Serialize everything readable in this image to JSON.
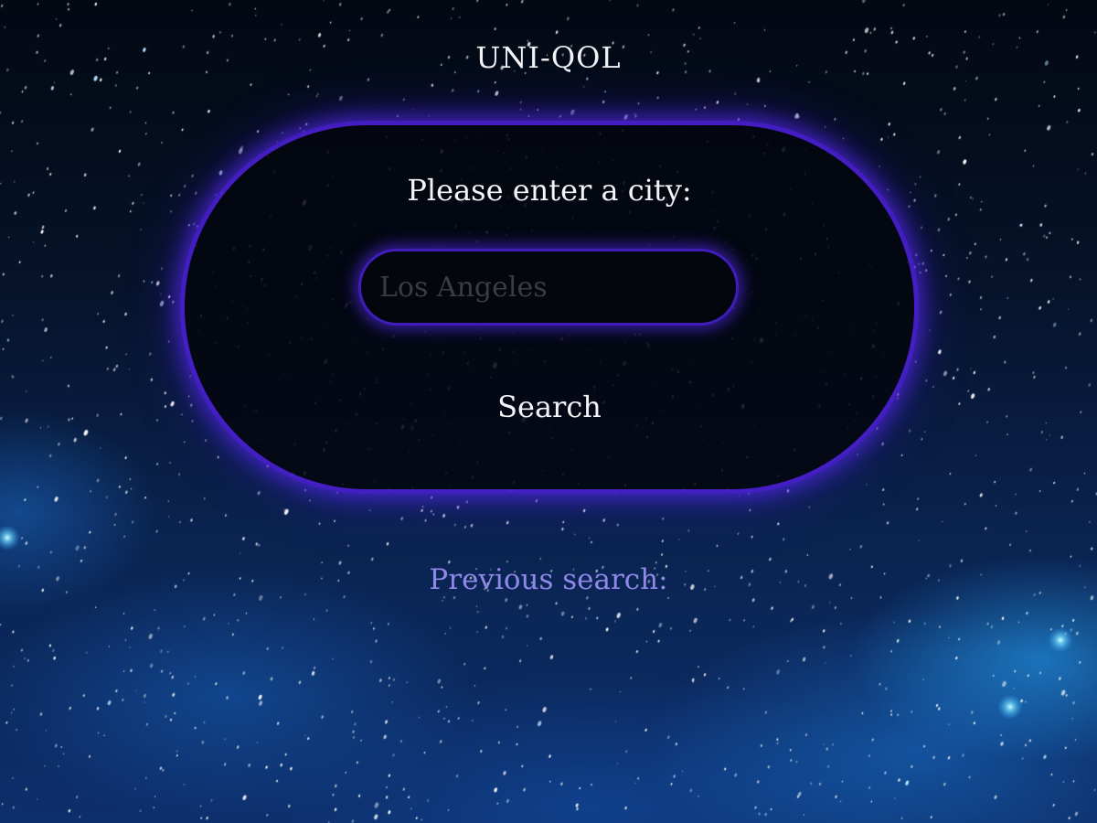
{
  "header": {
    "title": "UNI-QOL"
  },
  "search_panel": {
    "prompt": "Please enter a city:",
    "city_input_placeholder": "Los Angeles",
    "city_input_value": "",
    "search_label": "Search"
  },
  "history": {
    "label": "Previous search:"
  },
  "colors": {
    "panel_glow": "#5a2de0",
    "text": "#f4f4f8",
    "history_text": "#8f88e8",
    "placeholder": "#3b3b44"
  }
}
